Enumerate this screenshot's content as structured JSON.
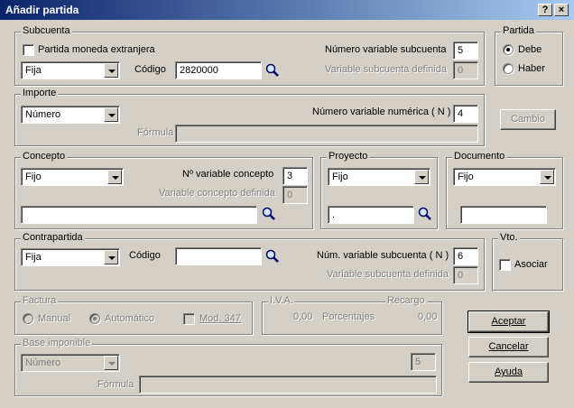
{
  "window": {
    "title": "Añadir partida",
    "help_btn": "?",
    "close_btn": "×"
  },
  "subcuenta": {
    "legend": "Subcuenta",
    "moneda_label": "Partida moneda extranjera",
    "tipo_value": "Fija",
    "codigo_label": "Código",
    "codigo_value": "2820000",
    "num_var_label": "Número variable subcuenta",
    "num_var_value": "5",
    "var_def_label": "Variable subcuenta definida",
    "var_def_value": "0"
  },
  "partida": {
    "legend": "Partida",
    "debe": "Debe",
    "haber": "Haber"
  },
  "importe": {
    "legend": "Importe",
    "tipo_value": "Número",
    "num_var_label": "Número variable numérica ( N )",
    "num_var_value": "4",
    "formula_label": "Fórmula",
    "formula_value": ""
  },
  "cambio_btn": "Cambio",
  "concepto": {
    "legend": "Concepto",
    "tipo_value": "Fijo",
    "num_var_label": "Nº variable concepto",
    "num_var_value": "3",
    "var_def_label": "Variable concepto definida",
    "var_def_value": "0",
    "text_value": ""
  },
  "proyecto": {
    "legend": "Proyecto",
    "tipo_value": "Fijo",
    "text_value": "."
  },
  "documento": {
    "legend": "Documento",
    "tipo_value": "Fijo",
    "text_value": ""
  },
  "contrapartida": {
    "legend": "Contrapartida",
    "tipo_value": "Fija",
    "codigo_label": "Código",
    "codigo_value": "",
    "num_var_label": "Núm. variable subcuenta ( N )",
    "num_var_value": "6",
    "var_def_label": "Variable subcuenta definida",
    "var_def_value": "0"
  },
  "vto": {
    "legend": "Vto.",
    "asociar": "Asociar"
  },
  "factura": {
    "legend": "Factura",
    "manual": "Manual",
    "automatico": "Automático",
    "mod347": "Mod. 347"
  },
  "iva": {
    "legend": "I.V.A.",
    "recargo_label": "Recargo",
    "iva_value": "0,00",
    "porcentajes_label": "Porcentajes",
    "recargo_value": "0,00"
  },
  "base": {
    "legend": "Base imponible",
    "tipo_value": "Número",
    "num_value": "5",
    "formula_label": "Fórmula",
    "formula_value": ""
  },
  "buttons": {
    "aceptar": "Aceptar",
    "cancelar": "Cancelar",
    "ayuda": "Ayuda"
  }
}
